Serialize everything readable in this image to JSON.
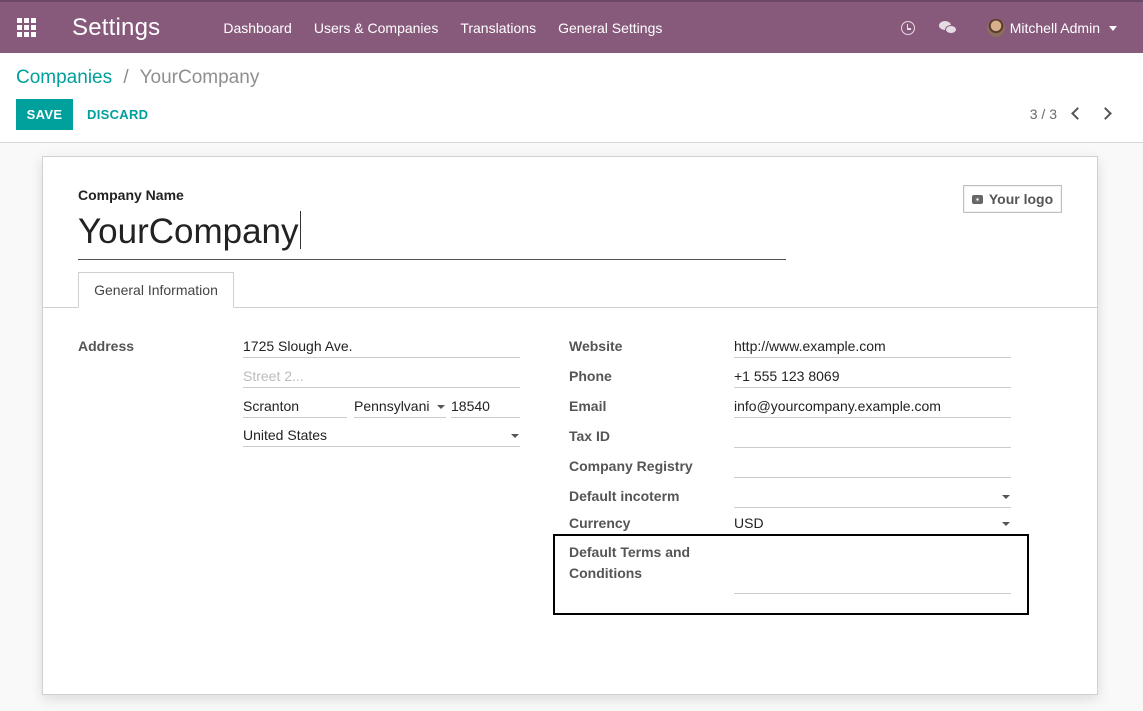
{
  "navbar": {
    "app_title": "Settings",
    "menu": [
      "Dashboard",
      "Users & Companies",
      "Translations",
      "General Settings"
    ],
    "user_name": "Mitchell Admin",
    "color": "#875a7b"
  },
  "breadcrumb": {
    "parent": "Companies",
    "separator": "/",
    "current": "YourCompany"
  },
  "toolbar": {
    "save_label": "SAVE",
    "discard_label": "DISCARD"
  },
  "pager": {
    "text": "3 / 3"
  },
  "form": {
    "company_name_label": "Company Name",
    "company_name": "YourCompany",
    "logo_button": "Your logo",
    "tab_label": "General Information",
    "address_label": "Address",
    "street": "1725 Slough Ave.",
    "street2_placeholder": "Street 2...",
    "city": "Scranton",
    "state": "Pennsylvani",
    "zip": "18540",
    "country": "United States",
    "website_label": "Website",
    "website": "http://www.example.com",
    "phone_label": "Phone",
    "phone": "+1 555 123 8069",
    "email_label": "Email",
    "email": "info@yourcompany.example.com",
    "tax_id_label": "Tax ID",
    "tax_id": "",
    "registry_label": "Company Registry",
    "registry": "",
    "incoterm_label": "Default incoterm",
    "incoterm": "",
    "currency_label": "Currency",
    "currency": "USD",
    "terms_label_line1": "Default Terms and",
    "terms_label_line2": "Conditions",
    "terms": ""
  },
  "colors": {
    "accent": "#00a09d",
    "navbar": "#875a7b"
  }
}
